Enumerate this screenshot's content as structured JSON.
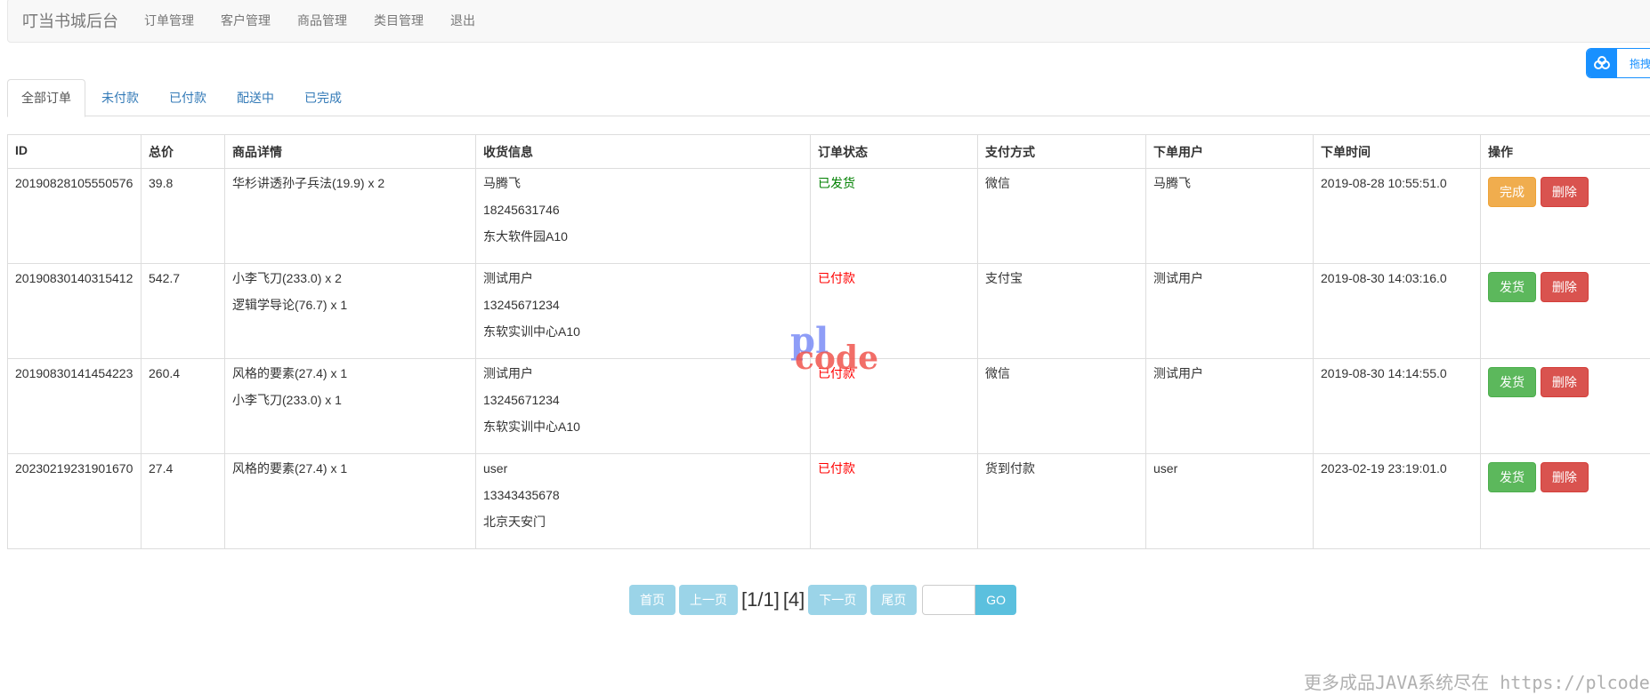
{
  "navbar": {
    "brand": "叮当书城后台",
    "links": [
      "订单管理",
      "客户管理",
      "商品管理",
      "类目管理",
      "退出"
    ]
  },
  "cloud_widget": {
    "text": "拖拽"
  },
  "tabs": [
    {
      "label": "全部订单",
      "active": true
    },
    {
      "label": "未付款",
      "active": false
    },
    {
      "label": "已付款",
      "active": false
    },
    {
      "label": "配送中",
      "active": false
    },
    {
      "label": "已完成",
      "active": false
    }
  ],
  "table": {
    "headers": [
      "ID",
      "总价",
      "商品详情",
      "收货信息",
      "订单状态",
      "支付方式",
      "下单用户",
      "下单时间",
      "操作"
    ],
    "rows": [
      {
        "id": "20190828105550576",
        "total": "39.8",
        "items": [
          "华杉讲透孙子兵法(19.9) x 2"
        ],
        "receiver": {
          "name": "马腾飞",
          "phone": "18245631746",
          "address": "东大软件园A10"
        },
        "status": "已发货",
        "payment": "微信",
        "user": "马腾飞",
        "time": "2019-08-28 10:55:51.0",
        "action_primary": "完成",
        "action_delete": "删除"
      },
      {
        "id": "20190830140315412",
        "total": "542.7",
        "items": [
          "小李飞刀(233.0) x 2",
          "逻辑学导论(76.7) x 1"
        ],
        "receiver": {
          "name": "测试用户",
          "phone": "13245671234",
          "address": "东软实训中心A10"
        },
        "status": "已付款",
        "payment": "支付宝",
        "user": "测试用户",
        "time": "2019-08-30 14:03:16.0",
        "action_primary": "发货",
        "action_delete": "删除"
      },
      {
        "id": "20190830141454223",
        "total": "260.4",
        "items": [
          "风格的要素(27.4) x 1",
          "小李飞刀(233.0) x 1"
        ],
        "receiver": {
          "name": "测试用户",
          "phone": "13245671234",
          "address": "东软实训中心A10"
        },
        "status": "已付款",
        "payment": "微信",
        "user": "测试用户",
        "time": "2019-08-30 14:14:55.0",
        "action_primary": "发货",
        "action_delete": "删除"
      },
      {
        "id": "20230219231901670",
        "total": "27.4",
        "items": [
          "风格的要素(27.4) x 1"
        ],
        "receiver": {
          "name": "user",
          "phone": "13343435678",
          "address": "北京天安门"
        },
        "status": "已付款",
        "payment": "货到付款",
        "user": "user",
        "time": "2023-02-19 23:19:01.0",
        "action_primary": "发货",
        "action_delete": "删除"
      }
    ]
  },
  "pagination": {
    "first": "首页",
    "prev": "上一页",
    "page_info": "[1/1]",
    "total_info": "[4]",
    "next": "下一页",
    "last": "尾页",
    "go": "GO",
    "input_value": ""
  },
  "watermark": {
    "logo_top": "pl",
    "logo_bottom": "code",
    "footer": "更多成品JAVA系统尽在 https://plcode.vip"
  },
  "colors": {
    "status_shipped": "#008000",
    "status_paid": "#ff0000",
    "btn_warning": "#f0ad4e",
    "btn_success": "#5cb85c",
    "btn_danger": "#d9534f",
    "link": "#337ab7"
  }
}
